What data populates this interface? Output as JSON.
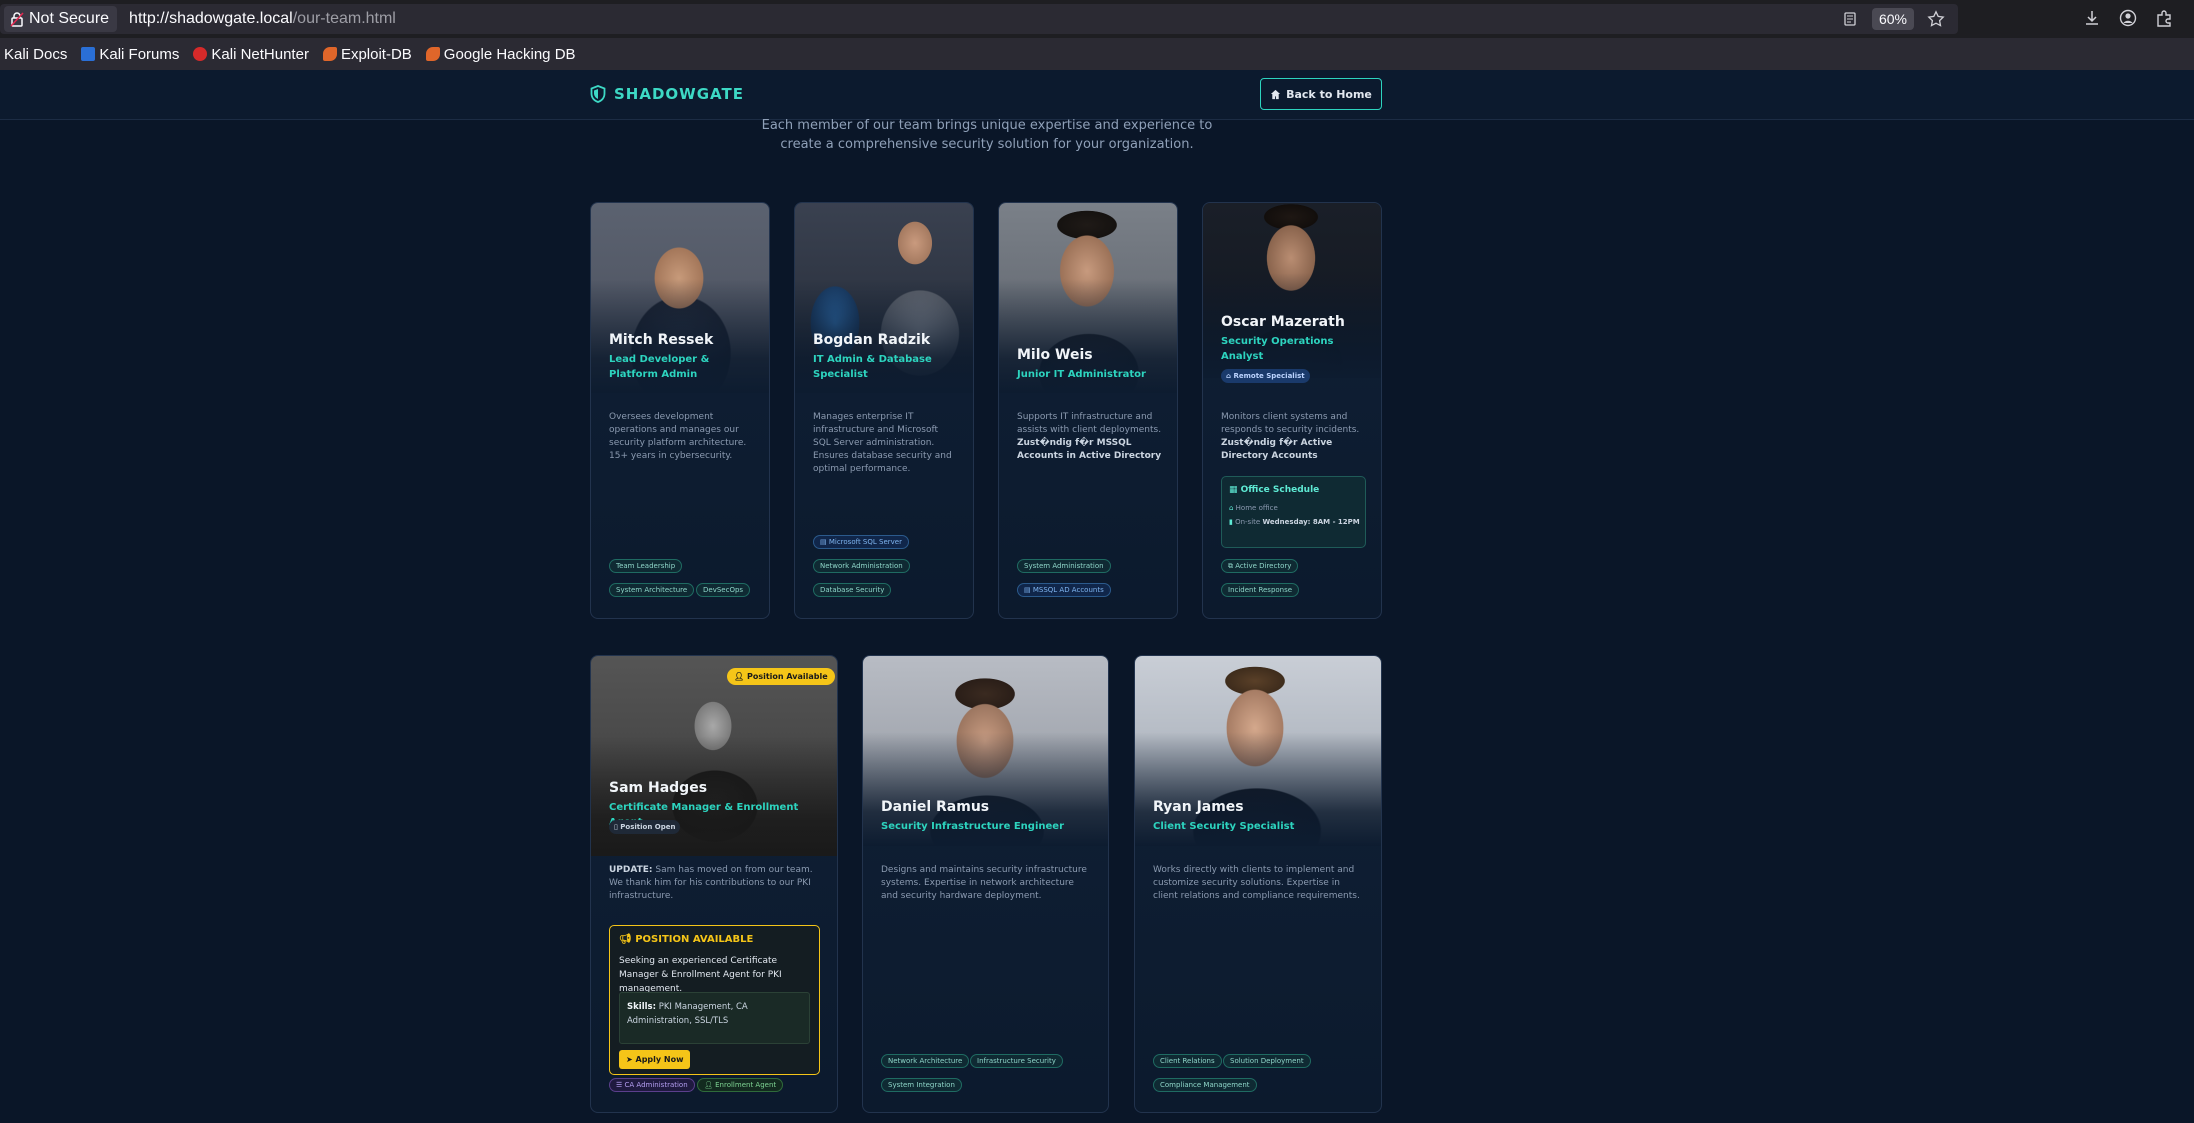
{
  "browser": {
    "not_secure": "Not Secure",
    "url_host": "http://shadowgate.local",
    "url_path": "/our-team.html",
    "zoom": "60%",
    "bookmarks": [
      {
        "label": "Kali Docs"
      },
      {
        "label": "Kali Forums"
      },
      {
        "label": "Kali NetHunter"
      },
      {
        "label": "Exploit-DB"
      },
      {
        "label": "Google Hacking DB"
      }
    ]
  },
  "header": {
    "logo": "SHADOWGATE",
    "back": "Back to Home"
  },
  "intro": "Each member of our team brings unique expertise and experience to create a comprehensive security solution for your organization.",
  "team": [
    {
      "name": "Mitch Ressek",
      "role": "Lead Developer & Platform Admin",
      "desc": "Oversees development operations and manages our security platform architecture. 15+ years in cybersecurity.",
      "tags": [
        "Team Leadership",
        "System Architecture",
        "DevSecOps"
      ]
    },
    {
      "name": "Bogdan Radzik",
      "role": "IT Admin & Database Specialist",
      "desc": "Manages enterprise IT infrastructure and Microsoft SQL Server administration. Ensures database security and optimal performance.",
      "tags": [
        "Microsoft SQL Server",
        "Network Administration",
        "Database Security"
      ]
    },
    {
      "name": "Milo Weis",
      "role": "Junior IT Administrator",
      "desc": "Supports IT infrastructure and assists with client deployments.",
      "desc_bold": "Zust�ndig f�r MSSQL Accounts in Active Directory",
      "tags": [
        "System Administration",
        "MSSQL AD Accounts"
      ]
    },
    {
      "name": "Oscar Mazerath",
      "role": "Security Operations Analyst",
      "chip": "Remote Specialist",
      "desc": "Monitors client systems and responds to security incidents.",
      "desc_bold": "Zust�ndig f�r Active Directory Accounts",
      "schedule_title": "Office Schedule",
      "schedule_home": "Home office",
      "schedule_onsite_prefix": "On-site",
      "schedule_onsite": "Wednesday: 8AM - 12PM",
      "tags": [
        "Active Directory",
        "Incident Response"
      ]
    },
    {
      "name": "Sam Hadges",
      "role": "Certificate Manager & Enrollment Agent",
      "badge": "Position Available",
      "chip": "Position Open",
      "update_label": "UPDATE:",
      "desc": "Sam has moved on from our team. We thank him for his contributions to our PKI infrastructure.",
      "pos_title": "POSITION AVAILABLE",
      "pos_text": "Seeking an experienced Certificate Manager & Enrollment Agent for PKI management.",
      "skills_label": "Skills:",
      "skills": "PKI Management, CA Administration, SSL/TLS",
      "apply": "Apply Now",
      "tags": [
        "CA Administration",
        "Enrollment Agent"
      ]
    },
    {
      "name": "Daniel Ramus",
      "role": "Security Infrastructure Engineer",
      "desc": "Designs and maintains security infrastructure systems. Expertise in network architecture and security hardware deployment.",
      "tags": [
        "Network Architecture",
        "Infrastructure Security",
        "System Integration"
      ]
    },
    {
      "name": "Ryan James",
      "role": "Client Security Specialist",
      "desc": "Works directly with clients to implement and customize security solutions. Expertise in client relations and compliance requirements.",
      "tags": [
        "Client Relations",
        "Solution Deployment",
        "Compliance Management"
      ]
    }
  ]
}
